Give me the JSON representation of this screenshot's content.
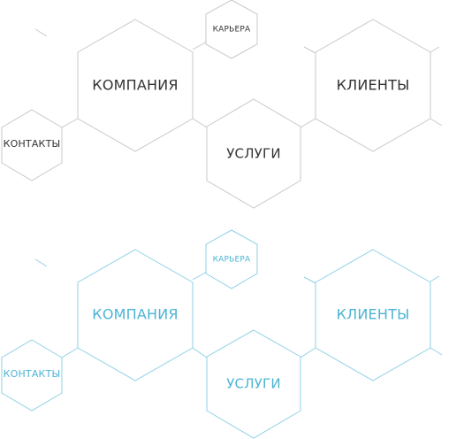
{
  "colors": {
    "grey_stroke": "#c8c8c8",
    "grey_text": "#333333",
    "blue_stroke": "#8fd0e6",
    "blue_text": "#4cb4d4",
    "background": "#ffffff"
  },
  "menu_default": {
    "company": "КОМПАНИЯ",
    "career": "КАРЬЕРА",
    "clients": "КЛИЕНТЫ",
    "services": "УСЛУГИ",
    "contacts": "КОНТАКТЫ"
  },
  "menu_hover": {
    "company": "КОМПАНИЯ",
    "career": "КАРЬЕРА",
    "clients": "КЛИЕНТЫ",
    "services": "УСЛУГИ",
    "contacts": "КОНТАКТЫ"
  }
}
